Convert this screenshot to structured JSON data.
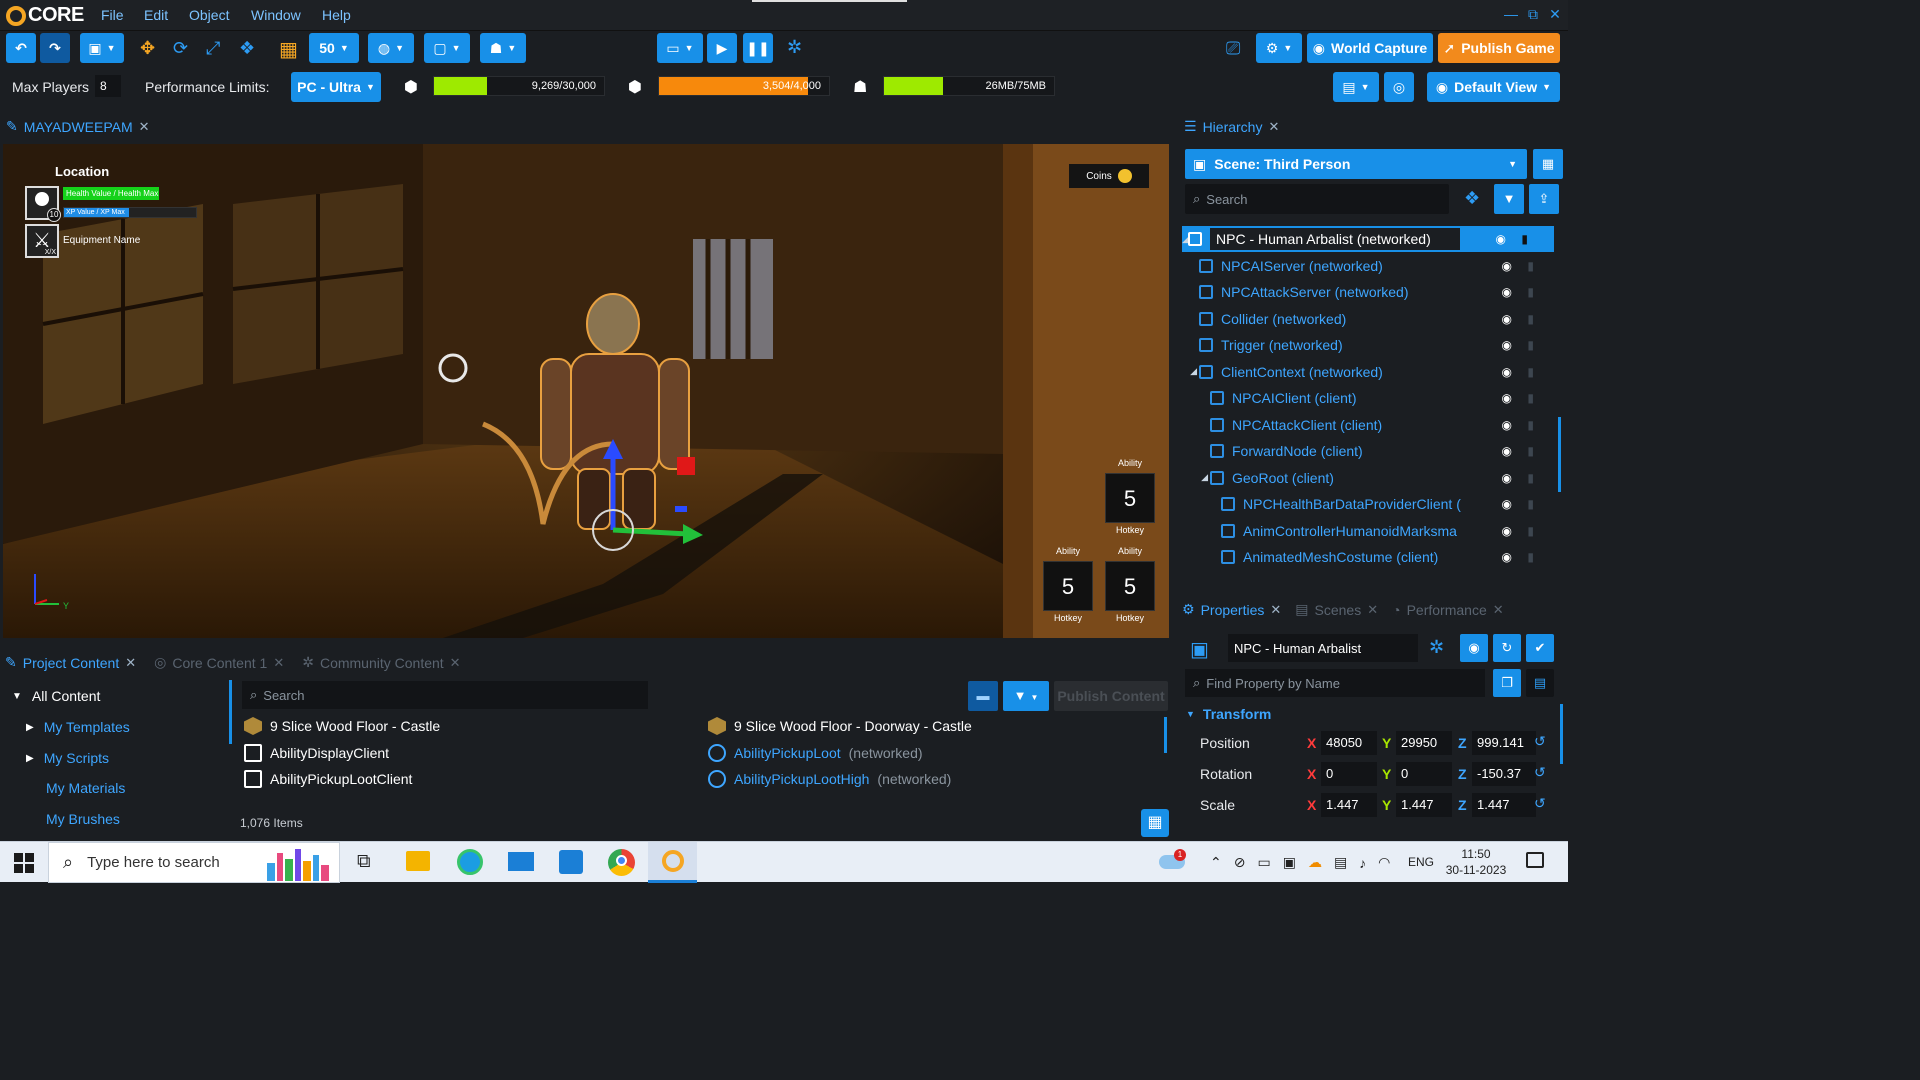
{
  "app": {
    "logo_text": "CORE"
  },
  "menu": [
    "File",
    "Edit",
    "Object",
    "Window",
    "Help"
  ],
  "window_controls": [
    "—",
    "⧉",
    "✕"
  ],
  "toolbar": {
    "grid_size": "50",
    "world_capture": "World Capture",
    "publish_game": "Publish Game",
    "default_view": "Default View"
  },
  "perf": {
    "max_players_label": "Max Players",
    "max_players_value": "8",
    "limits_label": "Performance Limits:",
    "limits_value": "PC - Ultra",
    "bars": [
      {
        "name": "objects",
        "value": "9,269/30,000",
        "fraction": 0.309,
        "color": "#9eea00"
      },
      {
        "name": "networked",
        "value": "3,504/4,000",
        "fraction": 0.876,
        "color": "#f7890c"
      },
      {
        "name": "memory",
        "value": "26MB/75MB",
        "fraction": 0.347,
        "color": "#9eea00"
      }
    ]
  },
  "viewport": {
    "tab": "MAYADWEEPAM",
    "hud": {
      "location": "Location",
      "health": "Health Value / Health Max",
      "xp": "XP Value / XP Max",
      "level": "10",
      "equipment": "Equipment Name",
      "equipment_count": "X/X",
      "coins": "Coins",
      "ability_label": "Ability",
      "ability_value": "5",
      "hotkey_label": "Hotkey",
      "axis_y": "Y"
    }
  },
  "hierarchy": {
    "tab": "Hierarchy",
    "scene": "Scene: Third Person",
    "search_placeholder": "Search",
    "items": [
      {
        "label": "NPC - Human Arbalist (networked)",
        "indent": 0,
        "selected": true,
        "white": true
      },
      {
        "label": "NPCAIServer (networked)",
        "indent": 1
      },
      {
        "label": "NPCAttackServer (networked)",
        "indent": 1
      },
      {
        "label": "Collider (networked)",
        "indent": 1
      },
      {
        "label": "Trigger (networked)",
        "indent": 1
      },
      {
        "label": "ClientContext (networked)",
        "indent": 1,
        "expanded": true
      },
      {
        "label": "NPCAIClient (client)",
        "indent": 2
      },
      {
        "label": "NPCAttackClient (client)",
        "indent": 2
      },
      {
        "label": "ForwardNode (client)",
        "indent": 2
      },
      {
        "label": "GeoRoot (client)",
        "indent": 2,
        "expanded": true
      },
      {
        "label": "NPCHealthBarDataProviderClient (",
        "indent": 3
      },
      {
        "label": "AnimControllerHumanoidMarksma",
        "indent": 3
      },
      {
        "label": "AnimatedMeshCostume (client)",
        "indent": 3
      }
    ]
  },
  "properties": {
    "tabs": [
      "Properties",
      "Scenes",
      "Performance"
    ],
    "object_name": "NPC - Human Arbalist",
    "find_placeholder": "Find Property by Name",
    "section": "Transform",
    "rows": [
      {
        "label": "Position",
        "x": "48050",
        "y": "29950",
        "z": "999.141"
      },
      {
        "label": "Rotation",
        "x": "0",
        "y": "0",
        "z": "-150.37"
      },
      {
        "label": "Scale",
        "x": "1.447",
        "y": "1.447",
        "z": "1.447"
      }
    ]
  },
  "content": {
    "tabs": [
      "Project Content",
      "Core Content 1",
      "Community Content"
    ],
    "tree": [
      "All Content",
      "My Templates",
      "My Scripts",
      "My Materials",
      "My Brushes"
    ],
    "search_placeholder": "Search",
    "publish_content": "Publish Content",
    "items_left": [
      {
        "name": "9 Slice Wood Floor - Castle",
        "suffix": "",
        "type": "template"
      },
      {
        "name": "AbilityDisplayClient",
        "suffix": "",
        "type": "script"
      },
      {
        "name": "AbilityPickupLootClient",
        "suffix": "",
        "type": "script"
      }
    ],
    "items_right": [
      {
        "name": "9 Slice Wood Floor - Doorway - Castle",
        "suffix": "",
        "type": "template"
      },
      {
        "name": "AbilityPickupLoot",
        "suffix": "(networked)",
        "type": "net"
      },
      {
        "name": "AbilityPickupLootHigh",
        "suffix": "(networked)",
        "type": "net"
      }
    ],
    "count": "1,076 Items"
  },
  "taskbar": {
    "search_placeholder": "Type here to search",
    "lang": "ENG",
    "time": "11:50",
    "date": "30-11-2023",
    "notif_badge": "1"
  }
}
